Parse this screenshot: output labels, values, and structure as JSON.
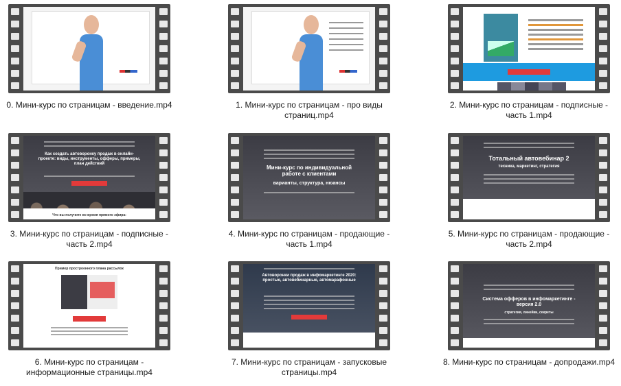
{
  "files": [
    {
      "name": "0. Мини-курс по страницам - введение.mp4",
      "thumb": "person-whiteboard"
    },
    {
      "name": "1. Мини-курс по страницам - про виды страниц.mp4",
      "thumb": "person-whiteboard-notes"
    },
    {
      "name": "2. Мини-курс по страницам - подписные - часть 1.mp4",
      "thumb": "book-landing"
    },
    {
      "name": "3. Мини-курс по страницам - подписные - часть 2.mp4",
      "thumb": "dark-landing"
    },
    {
      "name": "4. Мини-курс по страницам - продающие - часть 1.mp4",
      "thumb": "dark-landing"
    },
    {
      "name": "5. Мини-курс по страницам - продающие - часть 2.mp4",
      "thumb": "dark-landing"
    },
    {
      "name": "6. Мини-курс по страницам - информационные страницы.mp4",
      "thumb": "light-landing"
    },
    {
      "name": "7. Мини-курс по страницам - запусковые страницы.mp4",
      "thumb": "dark-landing"
    },
    {
      "name": "8. Мини-курс по страницам - допродажи.mp4",
      "thumb": "dark-landing"
    }
  ],
  "thumb_text": {
    "t3": "Как создать автоворонку продаж в онлайн-проекте: виды, инструменты, офферы, примеры, план действий",
    "t4": "Мини-курс по индивидуальной работе с клиентами",
    "t4sub": "варианты, структура, нюансы",
    "t5": "Тотальный автовебинар 2",
    "t5sub": "техника, маркетинг, стратегия",
    "t6": "Пример простроенного плана рассылок",
    "t7": "Автоворонки продаж в инфомаркетинге 2020: простые, автовебинарные, автомарафонные",
    "t8": "Система офферов в инфомаркетинге - версия 2.0",
    "t8sub": "стратегия, линейки, секреты",
    "t3foot": "Что вы получите во время прямого эфира:"
  }
}
